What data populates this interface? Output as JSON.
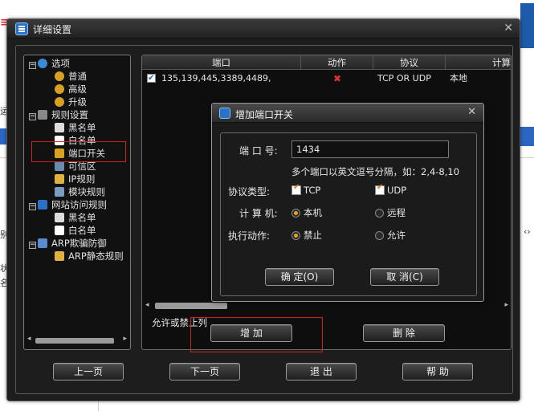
{
  "window": {
    "title": "详细设置"
  },
  "tree": {
    "items": [
      {
        "label": "选项"
      },
      {
        "label": "普通"
      },
      {
        "label": "高级"
      },
      {
        "label": "升级"
      },
      {
        "label": "规则设置"
      },
      {
        "label": "黑名单"
      },
      {
        "label": "白名单"
      },
      {
        "label": "端口开关"
      },
      {
        "label": "可信区"
      },
      {
        "label": "IP规则"
      },
      {
        "label": "模块规则"
      },
      {
        "label": "网站访问规则"
      },
      {
        "label": "黑名单"
      },
      {
        "label": "白名单"
      },
      {
        "label": "ARP欺骗防御"
      },
      {
        "label": "ARP静态规则"
      }
    ]
  },
  "port_list": {
    "columns": [
      "端口",
      "动作",
      "协议",
      "计算"
    ],
    "rows": [
      {
        "ports": "135,139,445,3389,4489,",
        "action_icon": "deny-x-icon",
        "protocol": "TCP OR UDP",
        "computer": "本地"
      }
    ],
    "note": "允许或禁止列"
  },
  "buttons": {
    "add": "增 加",
    "delete": "删 除",
    "prev": "上一页",
    "next": "下一页",
    "exit": "退 出",
    "help": "帮 助"
  },
  "dialog": {
    "title": "增加端口开关",
    "port_label": "端 口 号:",
    "port_value": "1434",
    "hint": "多个端口以英文逗号分隔，如：2,4-8,10",
    "protocol_label": "协议类型:",
    "protocol_tcp": "TCP",
    "protocol_udp": "UDP",
    "tcp_checked": true,
    "udp_checked": true,
    "computer_label": "计 算 机:",
    "computer_local": "本机",
    "computer_remote": "远程",
    "computer_selected": "本机",
    "action_label": "执行动作:",
    "action_deny": "禁止",
    "action_allow": "允许",
    "action_selected": "禁止",
    "ok": "确 定(O)",
    "cancel": "取 消(C)"
  },
  "background": {
    "left_glyphs": [
      "运",
      "别",
      "状",
      "名"
    ],
    "right_glyph": "‹›"
  }
}
